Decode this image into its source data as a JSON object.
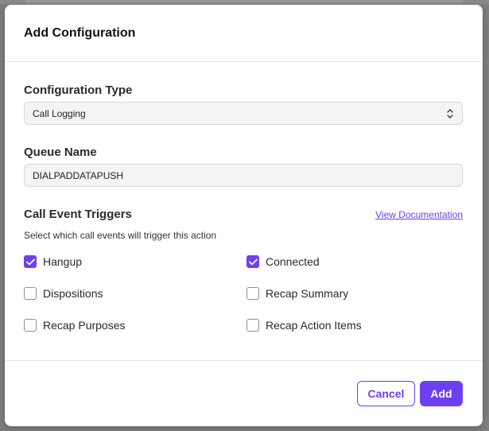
{
  "modal": {
    "title": "Add Configuration"
  },
  "configuration_type": {
    "label": "Configuration Type",
    "selected": "Call Logging",
    "icon": "chevron-up-down-icon"
  },
  "queue_name": {
    "label": "Queue Name",
    "value": "DIALPADDATAPUSH"
  },
  "triggers": {
    "label": "Call Event Triggers",
    "doc_link": "View Documentation",
    "helper": "Select which call events will trigger this action",
    "items": [
      {
        "label": "Hangup",
        "checked": true
      },
      {
        "label": "Connected",
        "checked": true
      },
      {
        "label": "Dispositions",
        "checked": false
      },
      {
        "label": "Recap Summary",
        "checked": false
      },
      {
        "label": "Recap Purposes",
        "checked": false
      },
      {
        "label": "Recap Action Items",
        "checked": false
      }
    ]
  },
  "footer": {
    "cancel_label": "Cancel",
    "add_label": "Add"
  },
  "colors": {
    "accent": "#6d3ff3",
    "backdrop": "#7f7f7f"
  }
}
